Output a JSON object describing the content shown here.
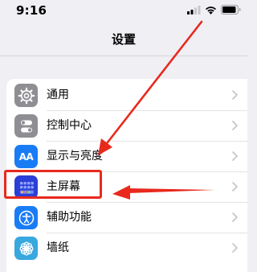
{
  "status_bar": {
    "time": "9:16",
    "icons": [
      "signal-icon",
      "wifi-icon",
      "battery-icon"
    ]
  },
  "nav": {
    "title": "设置"
  },
  "settings": {
    "items": [
      {
        "label": "通用",
        "icon": "gear-icon",
        "icon_color": "#8e8e93"
      },
      {
        "label": "控制中心",
        "icon": "toggle-switches-icon",
        "icon_color": "#8e8e93"
      },
      {
        "label": "显示与亮度",
        "icon": "display-text-size-icon",
        "icon_color": "#1a7cf5",
        "icon_text": "AA"
      },
      {
        "label": "主屏幕",
        "icon": "home-screen-grid-icon",
        "icon_color": "#2b3fd6"
      },
      {
        "label": "辅助功能",
        "icon": "accessibility-person-icon",
        "icon_color": "#1a7cf5"
      },
      {
        "label": "墙纸",
        "icon": "wallpaper-flower-icon",
        "icon_color": "#38a8df"
      }
    ]
  },
  "annotation": {
    "color": "#e8291c",
    "highlighted_item": "主屏幕"
  }
}
